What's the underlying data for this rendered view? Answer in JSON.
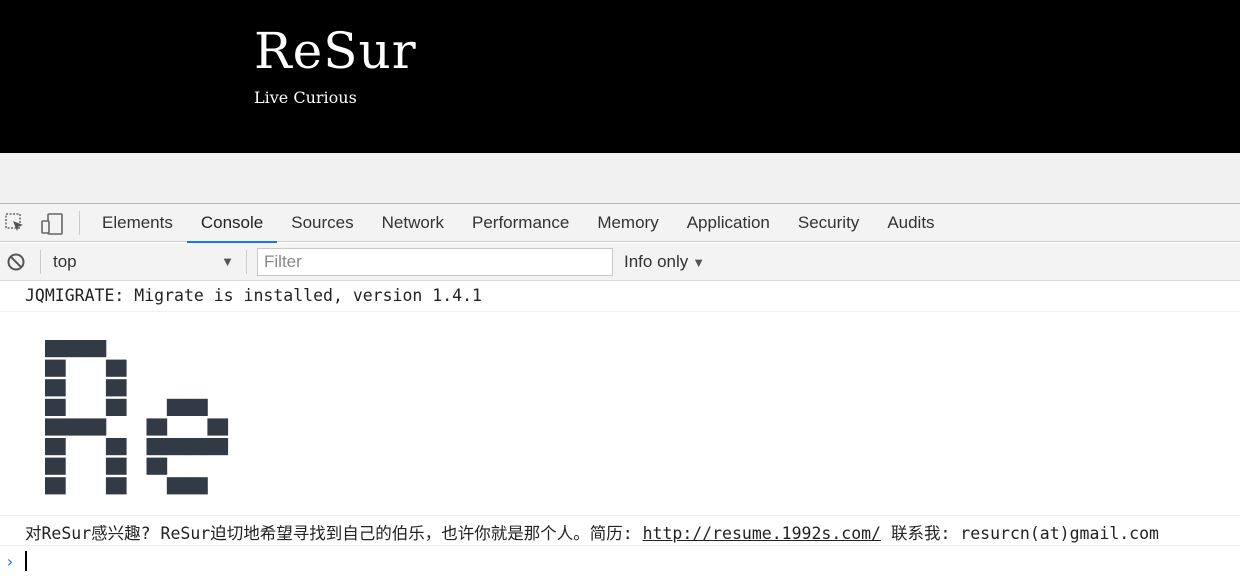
{
  "site": {
    "title": "ReSur",
    "tagline": "Live Curious"
  },
  "devtools": {
    "tabs": [
      "Elements",
      "Console",
      "Sources",
      "Network",
      "Performance",
      "Memory",
      "Application",
      "Security",
      "Audits"
    ],
    "active_tab": "Console",
    "toolbar_icons": [
      "inspect-element-icon",
      "device-toolbar-icon"
    ]
  },
  "filterbar": {
    "context": "top",
    "filter_placeholder": "Filter",
    "filter_value": "",
    "level": "Info only"
  },
  "console": {
    "messages": [
      {
        "text": "JQMIGRATE: Migrate is installed, version 1.4.1"
      },
      {
        "art_text": "Re",
        "art_color": "#323a45"
      },
      {
        "text_before": "对ReSur感兴趣? ReSur迫切地希望寻找到自己的伯乐，也许你就是那个人。简历:",
        "link": "http://resume.1992s.com/",
        "text_after": "联系我: resurcn(at)gmail.com"
      }
    ],
    "prompt_symbol": "›"
  },
  "colors": {
    "header_bg": "#000000",
    "accent": "#1a73e8",
    "art": "#323a45"
  }
}
